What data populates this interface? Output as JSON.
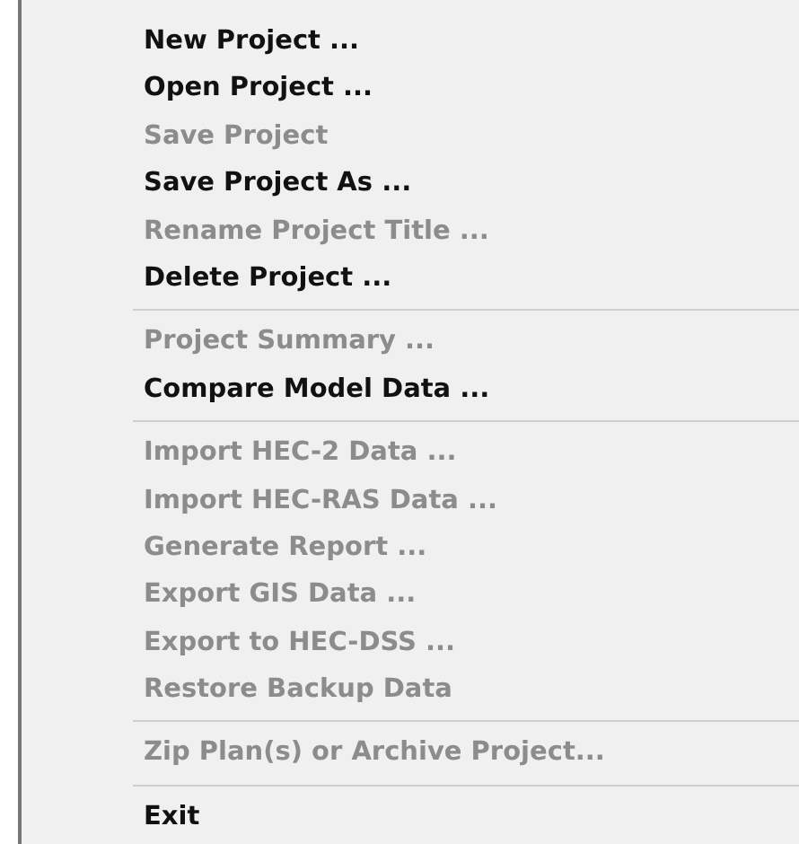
{
  "menu": {
    "groups": [
      {
        "items": [
          {
            "label": "New Project ...",
            "disabled": false
          },
          {
            "label": "Open Project ...",
            "disabled": false
          },
          {
            "label": "Save Project",
            "disabled": true
          },
          {
            "label": "Save Project As ...",
            "disabled": false
          },
          {
            "label": "Rename Project Title ...",
            "disabled": true
          },
          {
            "label": "Delete Project ...",
            "disabled": false
          }
        ]
      },
      {
        "items": [
          {
            "label": "Project Summary ...",
            "disabled": true
          },
          {
            "label": "Compare Model Data ...",
            "disabled": false
          }
        ]
      },
      {
        "items": [
          {
            "label": "Import HEC-2 Data ...",
            "disabled": true
          },
          {
            "label": "Import HEC-RAS Data ...",
            "disabled": true
          },
          {
            "label": "Generate Report ...",
            "disabled": true
          },
          {
            "label": "Export GIS Data ...",
            "disabled": true
          },
          {
            "label": "Export to HEC-DSS ...",
            "disabled": true
          },
          {
            "label": "Restore Backup Data",
            "disabled": true
          }
        ]
      },
      {
        "items": [
          {
            "label": "Zip Plan(s) or Archive Project...",
            "disabled": true
          }
        ]
      },
      {
        "items": [
          {
            "label": "Exit",
            "disabled": false
          }
        ]
      }
    ]
  }
}
